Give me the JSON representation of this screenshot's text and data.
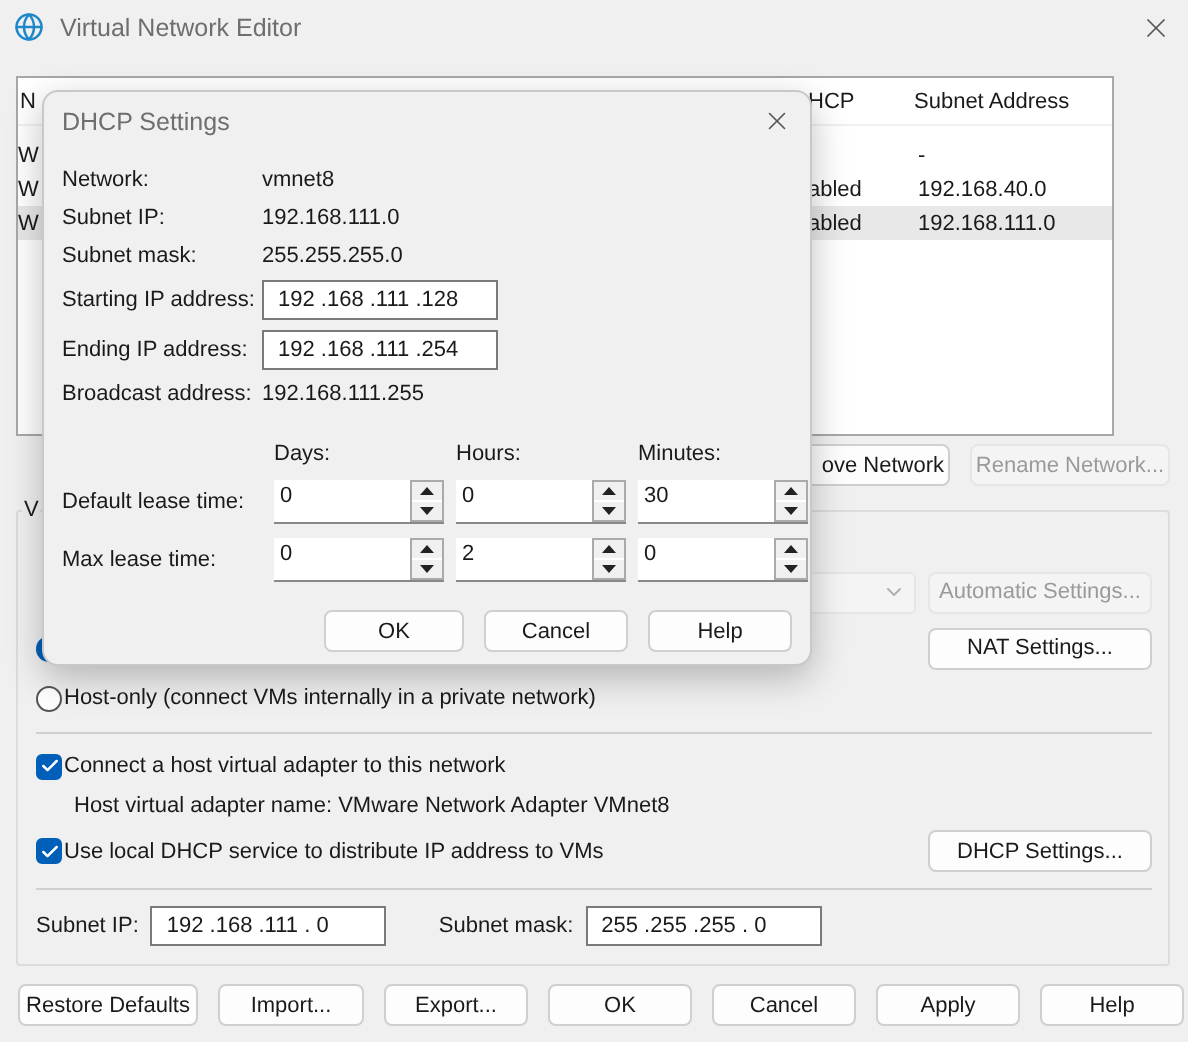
{
  "window": {
    "title": "Virtual Network Editor"
  },
  "networks_table": {
    "columns": [
      "N",
      "HCP",
      "Subnet Address"
    ],
    "rows": [
      {
        "cells": [
          "W",
          "",
          "-"
        ],
        "selected": false
      },
      {
        "cells": [
          "W",
          "abled",
          "192.168.40.0"
        ],
        "selected": false
      },
      {
        "cells": [
          "W",
          "abled",
          "192.168.111.0"
        ],
        "selected": true
      }
    ]
  },
  "table_buttons": [
    {
      "label": "ove Network",
      "disabled": false
    },
    {
      "label": "Rename Network...",
      "disabled": true
    }
  ],
  "vmnet_info": {
    "group_label": "V",
    "nat_radio": {
      "selected": true
    },
    "automatic_settings": {
      "label": "Automatic Settings...",
      "disabled": true
    },
    "nat_settings": "NAT Settings...",
    "host_only": {
      "label": "Host-only (connect VMs internally in a private network)",
      "selected": false
    },
    "connect_adapter": {
      "label": "Connect a host virtual adapter to this network",
      "checked": true
    },
    "adapter_name": "Host virtual adapter name: VMware Network Adapter VMnet8",
    "use_dhcp": {
      "label": "Use local DHCP service to distribute IP address to VMs",
      "checked": true
    },
    "dhcp_settings": "DHCP Settings...",
    "subnet_ip": {
      "label": "Subnet IP:",
      "value": "192 .168 .111 . 0"
    },
    "subnet_mask": {
      "label": "Subnet mask:",
      "value": "255 .255 .255 . 0"
    }
  },
  "buttons": [
    "Restore Defaults",
    "Import...",
    "Export...",
    "OK",
    "Cancel",
    "Apply",
    "Help"
  ],
  "dhcp_dialog": {
    "title": "DHCP Settings",
    "info": [
      {
        "kind": "text",
        "label": "Network:",
        "value": "vmnet8"
      },
      {
        "kind": "text",
        "label": "Subnet IP:",
        "value": "192.168.111.0"
      },
      {
        "kind": "text",
        "label": "Subnet mask:",
        "value": "255.255.255.0"
      },
      {
        "kind": "field",
        "label": "Starting IP address:",
        "value": "192 .168 .111 .128"
      },
      {
        "kind": "field",
        "label": "Ending IP address:",
        "value": "192 .168 .111 .254"
      },
      {
        "kind": "text",
        "label": "Broadcast address:",
        "value": "192.168.111.255"
      }
    ],
    "lease_columns": [
      "Days:",
      "Hours:",
      "Minutes:"
    ],
    "lease_rows": [
      {
        "label": "Default lease time:",
        "values": [
          "0",
          "0",
          "30"
        ]
      },
      {
        "label": "Max lease time:",
        "values": [
          "0",
          "2",
          "0"
        ]
      }
    ],
    "buttons": [
      "OK",
      "Cancel",
      "Help"
    ]
  }
}
